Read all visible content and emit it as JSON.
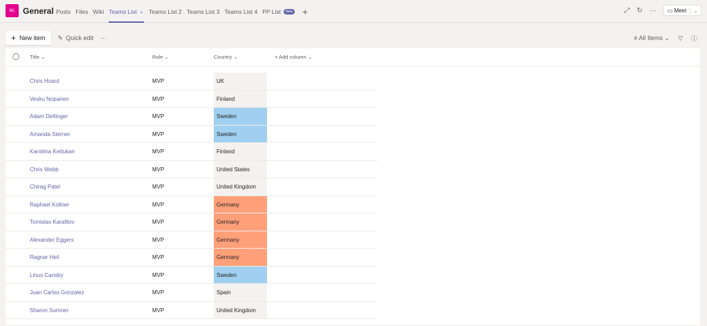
{
  "header": {
    "avatar": "ML",
    "channel": "General",
    "tabs": [
      "Posts",
      "Files",
      "Wiki",
      "Teams List",
      "Teams List 2",
      "Teams List 3",
      "Teams List 4",
      "PP List"
    ],
    "active_tab": "Teams List",
    "new_badge": "New",
    "meet": "Meet"
  },
  "commands": {
    "new_item": "New item",
    "quick_edit": "Quick edit",
    "more": "···",
    "view": "All Items"
  },
  "columns": {
    "title": "Title",
    "role": "Role",
    "country": "Country",
    "add": "Add column"
  },
  "colors": {
    "accent": "#6264a7",
    "sweden": "#a0cfef",
    "germany": "#ffa07a",
    "default": "#f3f2f1"
  },
  "rows": [
    {
      "title": "Chris Hoard",
      "role": "MVP",
      "country": "UK"
    },
    {
      "title": "Vesku Nopanen",
      "role": "MVP",
      "country": "Finland"
    },
    {
      "title": "Adam Deltinger",
      "role": "MVP",
      "country": "Sweden"
    },
    {
      "title": "Amanda Sterner",
      "role": "MVP",
      "country": "Sweden"
    },
    {
      "title": "Karoliina Kettukari",
      "role": "MVP",
      "country": "Finland"
    },
    {
      "title": "Chris Webb",
      "role": "MVP",
      "country": "United States"
    },
    {
      "title": "Chirag Patel",
      "role": "MVP",
      "country": "United Kingdom"
    },
    {
      "title": "Raphael Kollner",
      "role": "MVP",
      "country": "Germany"
    },
    {
      "title": "Tomislav Karafilov",
      "role": "MVP",
      "country": "Germany"
    },
    {
      "title": "Alexander Eggers",
      "role": "MVP",
      "country": "Germany"
    },
    {
      "title": "Ragnar Heil",
      "role": "MVP",
      "country": "Germany"
    },
    {
      "title": "Linus Cansby",
      "role": "MVP",
      "country": "Sweden"
    },
    {
      "title": "Juan Carlos Gonzalez",
      "role": "MVP",
      "country": "Spain"
    },
    {
      "title": "Sharon Sumner",
      "role": "MVP",
      "country": "United Kingdom"
    }
  ]
}
